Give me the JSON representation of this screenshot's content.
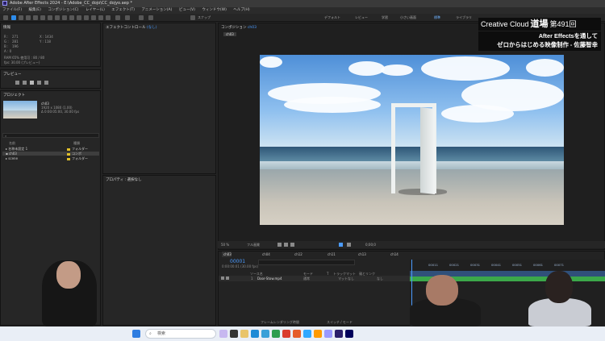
{
  "window": {
    "title": "Adobe After Effects 2024 - E:\\Adobe_CC_dojo\\CC_dojyo.aep *",
    "menu": [
      "ファイル(F)",
      "編集(E)",
      "コンポジション(C)",
      "レイヤー(L)",
      "エフェクト(T)",
      "アニメーション(A)",
      "ビュー(V)",
      "ウィンドウ(W)",
      "ヘルプ(H)"
    ]
  },
  "toolbar": {
    "snap_label": "スナップ",
    "workspaces": [
      "デフォルト",
      "レビュー",
      "学習",
      "小さい画面",
      "標準",
      "ライブラリ"
    ],
    "active_workspace_index": 4
  },
  "info_panel": {
    "title": "情報",
    "r": "R :",
    "g": "G :",
    "b": "B :",
    "a": "A : 0",
    "x": "X : 1434",
    "y": "Y : 118",
    "rgb_values": [
      "271",
      "281",
      "196"
    ],
    "status": [
      "RAM 65% 使用可 : 80 / 80",
      "fps: 30.00 (プレビュー)"
    ]
  },
  "preview_panel": {
    "title": "プレビュー"
  },
  "project_panel": {
    "title": "プロジェクト",
    "selected_name": "ch03",
    "selected_meta": [
      "1920 x 1080 (1.00)",
      "Δ 0:00:05:00, 30.00 fps"
    ],
    "search_placeholder": "",
    "columns": [
      "名前",
      "種類"
    ],
    "items": [
      {
        "name": "名称未設定 1",
        "type": "フォルダー",
        "color": "#e1c02b"
      },
      {
        "name": "ch03",
        "type": "コンポ",
        "color": "#e1c02b"
      },
      {
        "name": "scene",
        "type": "フォルダー",
        "color": "#e1c02b"
      }
    ]
  },
  "effect_panel": {
    "title_prefix": "エフェクトコントロール",
    "title_value": "(なし)"
  },
  "properties_panel": {
    "title": "プロパティ : 選択なし"
  },
  "composition_panel": {
    "title_prefix": "コンポジション",
    "title_value": "ch03",
    "tab": "ch03",
    "zoom": "50 %",
    "resolution": "フル画質",
    "frame": "0;00;0"
  },
  "timeline": {
    "tabs": [
      "ch03",
      "ch04",
      "ch12",
      "ch11",
      "ch13",
      "ch14"
    ],
    "timecode": "00001",
    "fps_text": "0:00:00:01 (30.00 fps)",
    "columns": [
      "ソース名",
      "モード",
      "T",
      "トラックマット",
      "親とリンク"
    ],
    "layer": {
      "index": "1",
      "name": "Door-Stow.mp4",
      "mode": "通常",
      "trackmatte": "マットなし",
      "parent": "なし"
    },
    "ruler": [
      "00011",
      "00021",
      "00031",
      "00041",
      "00051",
      "00061",
      "00071"
    ],
    "footer_left": "フレームレンダリング時間",
    "footer_right": "スイッチ / モード"
  },
  "overlay": {
    "brand": "Creative Cloud",
    "dojo": "道場",
    "episode": "第491回",
    "line1": "After Effectsを通して",
    "line2": "ゼロからはじめる映像制作 - 佐藤智幸"
  },
  "taskbar": {
    "search_placeholder": "検索"
  },
  "colors": {
    "accent": "#2d8ceb",
    "timeline_green": "#3ba84a",
    "label_yellow": "#e1c02b"
  }
}
